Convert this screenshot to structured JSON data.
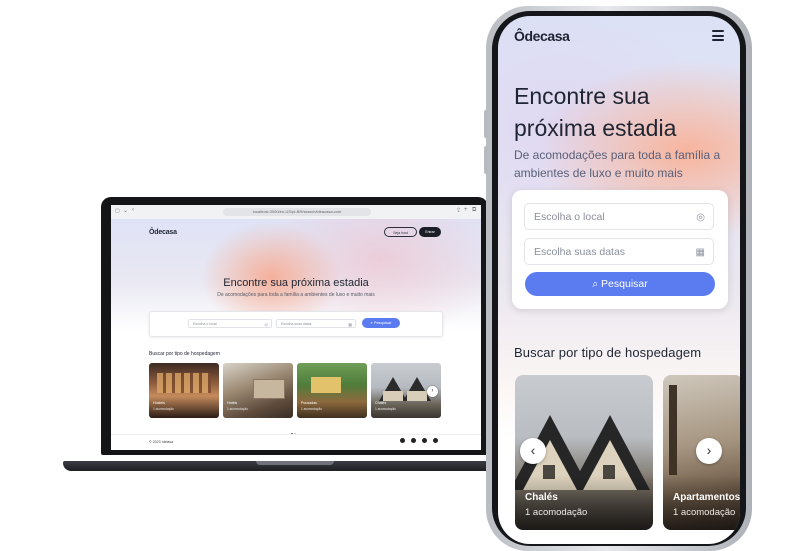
{
  "laptop": {
    "url": "localhost:3000/en-US/pt-BR/search/ideacasa.com",
    "logo": "Ôdecasa",
    "header_buttons": [
      "Seja host",
      "Entrar"
    ],
    "hero_title": "Encontre sua próxima estadia",
    "hero_subtitle": "De acomodações para toda a família a ambientes de luxo e muito mais",
    "search": {
      "location_placeholder": "Escolha o local",
      "dates_placeholder": "Escolha suas datas",
      "button_label": "Pesquisar"
    },
    "section_title": "Buscar por tipo de hospedagem",
    "cards": [
      {
        "name": "Hostels",
        "count": "1 acomodação"
      },
      {
        "name": "Hotéis",
        "count": "1 acomodação"
      },
      {
        "name": "Pousadas",
        "count": "1 acomodação"
      },
      {
        "name": "Chalés",
        "count": "1 acomodação"
      }
    ],
    "footer": "© 2023 Ideiasa",
    "social_icons": [
      "instagram-icon",
      "twitter-icon",
      "youtube-icon",
      "github-icon"
    ]
  },
  "phone": {
    "logo": "Ôdecasa",
    "hero_title": "Encontre sua próxima estadia",
    "hero_subtitle": "De acomodações para toda a família a ambientes de luxo e muito mais",
    "search": {
      "location_placeholder": "Escolha o local",
      "dates_placeholder": "Escolha suas datas",
      "button_label": "Pesquisar"
    },
    "section_title": "Buscar por tipo de hospedagem",
    "cards": [
      {
        "name": "Chalés",
        "count": "1 acomodação"
      },
      {
        "name": "Apartamentos",
        "count": "1 acomodação"
      }
    ]
  },
  "colors": {
    "accent": "#5b7cf0",
    "text_dark": "#1f2533",
    "hero_peach": "#f6aa91",
    "hero_lavender": "#dfe3f6"
  }
}
